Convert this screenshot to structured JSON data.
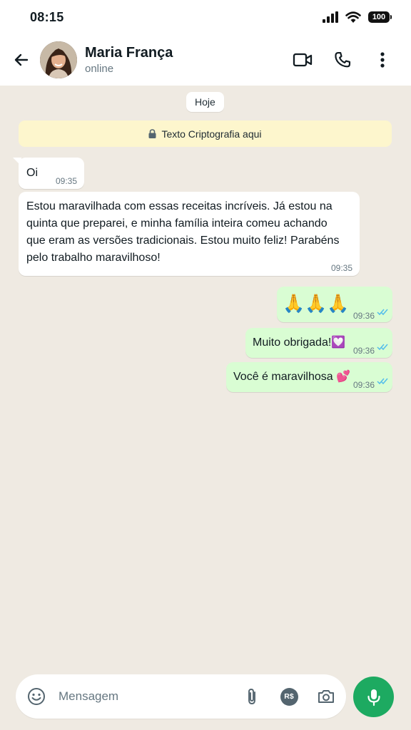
{
  "status_bar": {
    "time": "08:15",
    "battery": "100"
  },
  "header": {
    "contact_name": "Maria França",
    "contact_status": "online",
    "icons": [
      "back-arrow-icon",
      "video-call-icon",
      "phone-icon",
      "more-vertical-icon"
    ]
  },
  "chat": {
    "date_chip": "Hoje",
    "encryption_notice": "Texto Criptografia aqui",
    "messages": [
      {
        "direction": "in",
        "text": "Oi",
        "time": "09:35"
      },
      {
        "direction": "in",
        "lines": [
          "Estou maravilhada com essas receitas incríveis. Já estou na",
          "quinta que preparei, e minha família inteira comeu achando",
          "que eram as versões tradicionais. Estou muito feliz! Parabéns",
          "pelo trabalho maravilhoso!"
        ],
        "time": "09:35"
      },
      {
        "direction": "out",
        "text": "🙏🙏🙏",
        "time": "09:36",
        "status": "read"
      },
      {
        "direction": "out",
        "text": "Muito obrigada!💟",
        "time": "09:36",
        "status": "read"
      },
      {
        "direction": "out",
        "text": "Você é maravilhosa 💕",
        "time": "09:36",
        "status": "read"
      }
    ]
  },
  "composer": {
    "placeholder": "Mensagem",
    "icons": [
      "emoji-icon",
      "attach-icon",
      "payment-icon",
      "camera-icon",
      "mic-icon"
    ],
    "payment_label": "R$"
  },
  "colors": {
    "accent_green": "#1daa61",
    "incoming_bubble": "#ffffff",
    "outgoing_bubble": "#d9fdd3",
    "chat_background": "#efeae2",
    "read_ticks": "#53bdeb",
    "encryption_bg": "#fdf6cd"
  }
}
